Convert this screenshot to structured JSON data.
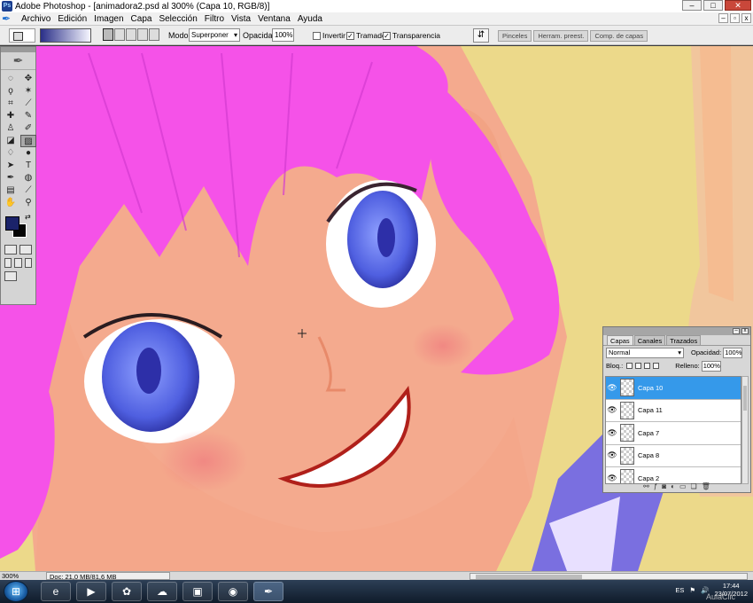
{
  "window": {
    "title": "Adobe Photoshop - [animadora2.psd al 300% (Capa 10, RGB/8)]",
    "logo_text": "Ps",
    "controls": [
      "–",
      "□",
      "✕"
    ]
  },
  "menu": {
    "items": [
      "Archivo",
      "Edición",
      "Imagen",
      "Capa",
      "Selección",
      "Filtro",
      "Vista",
      "Ventana",
      "Ayuda"
    ],
    "doc_controls": [
      "–",
      "▫",
      "x"
    ]
  },
  "options_bar": {
    "mode_label": "Modo:",
    "mode_value": "Superponer",
    "opacity_label": "Opacidad:",
    "opacity_value": "100%",
    "invert_label": "Invertir",
    "dither_label": "Tramado",
    "transparency_label": "Transparencia",
    "invert_checked": false,
    "dither_checked": true,
    "transparency_checked": true,
    "palette_tabs": [
      "Pinceles",
      "Herram. preest.",
      "Comp. de capas"
    ],
    "gradient_colors": [
      "#2a2f88",
      "#f6f6ff"
    ]
  },
  "tools": {
    "icons": [
      "marquee-icon",
      "move-icon",
      "lasso-icon",
      "magic-wand-icon",
      "crop-icon",
      "slice-icon",
      "healing-brush-icon",
      "brush-icon",
      "clone-stamp-icon",
      "history-brush-icon",
      "eraser-icon",
      "gradient-icon",
      "blur-icon",
      "dodge-icon",
      "path-selection-icon",
      "type-icon",
      "pen-icon",
      "shape-icon",
      "notes-icon",
      "eyedropper-icon",
      "hand-icon",
      "zoom-icon"
    ],
    "selected_tool": "gradient-icon",
    "foreground_color": "#1b236a",
    "background_color": "#050505"
  },
  "layers_panel": {
    "tabs": [
      "Capas",
      "Canales",
      "Trazados"
    ],
    "active_tab": "Capas",
    "blend_mode": "Normal",
    "opacity_label": "Opacidad:",
    "opacity_value": "100%",
    "lock_label": "Bloq.:",
    "fill_label": "Relleno:",
    "fill_value": "100%",
    "layers": [
      {
        "name": "Capa 10",
        "active": true
      },
      {
        "name": "Capa 11",
        "active": false
      },
      {
        "name": "Capa 7",
        "active": false
      },
      {
        "name": "Capa 8",
        "active": false
      },
      {
        "name": "Capa 2",
        "active": false
      }
    ],
    "footer_icons": [
      "link-icon",
      "layer-style-icon",
      "mask-icon",
      "adjustment-icon",
      "group-icon",
      "new-layer-icon",
      "trash-icon"
    ]
  },
  "status": {
    "zoom": "300%",
    "doc": "Doc: 21,0 MB/81,6 MB"
  },
  "taskbar": {
    "language": "ES",
    "time": "17:44",
    "date": "23/07/2012",
    "apps": [
      "internet-explorer-icon",
      "media-player-icon",
      "paint-icon",
      "network-icon",
      "video-icon",
      "chrome-icon",
      "photoshop-icon"
    ],
    "active_app": "photoshop-icon"
  },
  "watermark": "AulaClic"
}
